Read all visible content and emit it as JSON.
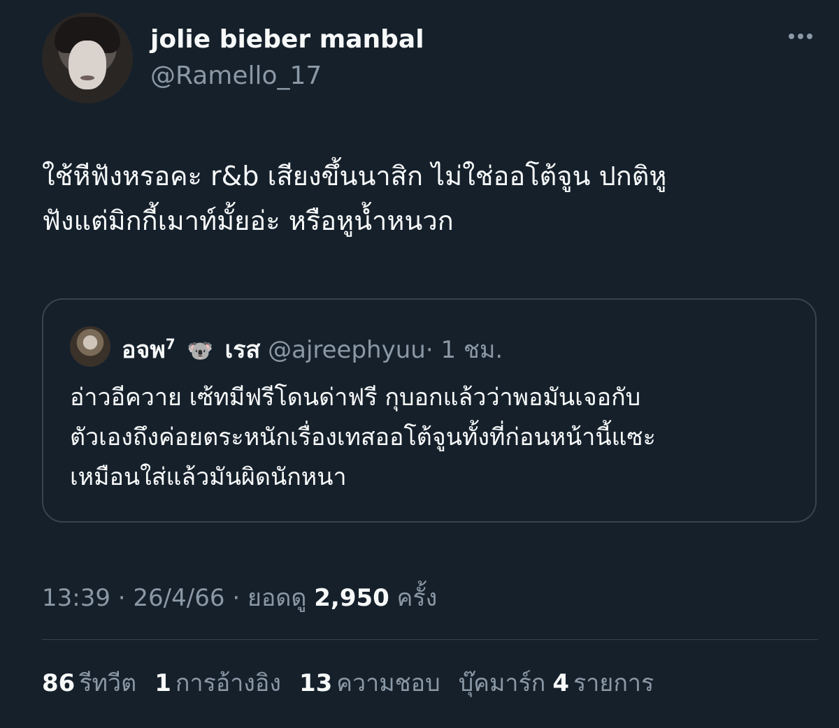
{
  "author": {
    "display_name": "jolie bieber manbal",
    "handle": "@Ramello_17"
  },
  "tweet": {
    "text_line_1": "ใช้หีฟังหรอคะ r&b เสียงขึ้นนาสิก ไม่ใช่ออโต้จูน ปกติหู",
    "text_line_2": "ฟังแต่มิกกี้เมาท์มั้ยอ่ะ หรือหูน้ำหนวก"
  },
  "quoted_tweet": {
    "display_name": "อจพ",
    "name_superscript": "7",
    "emoji": "🐨",
    "name_suffix": "เรส",
    "handle": "@ajreephyuu",
    "time": "· 1 ชม.",
    "text_line_1": "อ่าวอีควาย เซ้ทมีฟรีโดนด่าฟรี กุบอกแล้วว่าพอมันเจอกับ",
    "text_line_2": "ตัวเองถึงค่อยตระหนักเรื่องเทสออโต้จูนทั้งที่ก่อนหน้านี้แซะ",
    "text_line_3": "เหมือนใส่แล้วมันผิดนักหนา"
  },
  "meta": {
    "time": "13:39",
    "sep1": "·",
    "date": "26/4/66",
    "sep2": "·",
    "views_label": "ยอดดู",
    "views_count": "2,950",
    "views_unit": "ครั้ง"
  },
  "stats": {
    "retweets_count": "86",
    "retweets_label": "รีทวีต",
    "quotes_count": "1",
    "quotes_label": "การอ้างอิง",
    "likes_count": "13",
    "likes_label": "ความชอบ",
    "bookmarks_label": "บุ๊คมาร์ก",
    "bookmarks_count": "4",
    "bookmarks_unit": "รายการ"
  },
  "icons": {
    "more": "more-horizontal-icon"
  },
  "colors": {
    "background": "#15202b",
    "primary_text": "#f7f9f9",
    "secondary_text": "#8b98a5",
    "border": "#38444d"
  }
}
